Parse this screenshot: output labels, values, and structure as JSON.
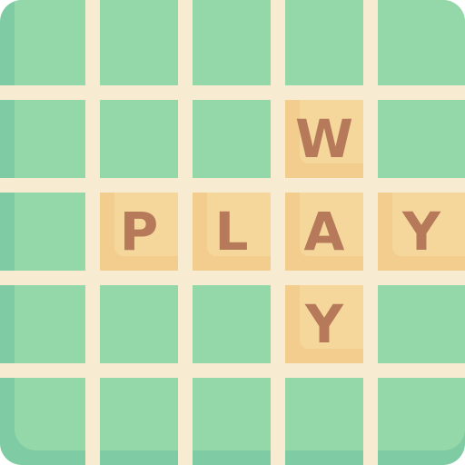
{
  "board": {
    "colors": {
      "frame": "#7ecba4",
      "cell": "#94d8a9",
      "grid_line": "#f7ecd2",
      "tile": "#f2cd8e",
      "tile_highlight": "#f6d79b",
      "letter": "#b67a5a"
    },
    "rows": 5,
    "columns": 5,
    "tiles": [
      {
        "letter": "W",
        "row": 1,
        "col": 3
      },
      {
        "letter": "P",
        "row": 2,
        "col": 1
      },
      {
        "letter": "L",
        "row": 2,
        "col": 2
      },
      {
        "letter": "A",
        "row": 2,
        "col": 3
      },
      {
        "letter": "Y",
        "row": 2,
        "col": 4
      },
      {
        "letter": "Y",
        "row": 3,
        "col": 3
      }
    ]
  }
}
